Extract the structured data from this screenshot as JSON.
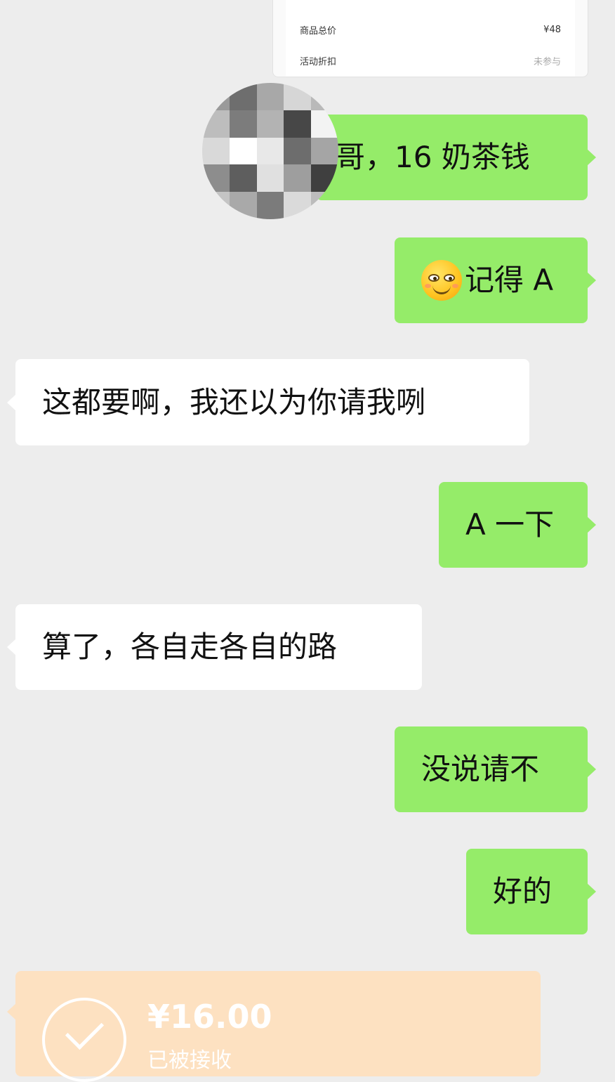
{
  "order_card": {
    "rows": [
      {
        "label": "商品总价",
        "value": "¥48"
      },
      {
        "label": "活动折扣",
        "value": "未参与"
      }
    ]
  },
  "messages": [
    {
      "direction": "out",
      "text": "哥，16 奶茶钱"
    },
    {
      "direction": "out",
      "emoji": "smug-face-icon",
      "text": "记得 A"
    },
    {
      "direction": "in",
      "text": "这都要啊，我还以为你请我咧"
    },
    {
      "direction": "out",
      "text": "A 一下"
    },
    {
      "direction": "in",
      "text": "算了，各自走各自的路"
    },
    {
      "direction": "out",
      "text": "没说请不"
    },
    {
      "direction": "out",
      "text": "好的"
    }
  ],
  "transfer": {
    "amount": "¥16.00",
    "status": "已被接收"
  },
  "colors": {
    "background": "#ededed",
    "outgoing_bubble": "#95ec69",
    "incoming_bubble": "#ffffff",
    "transfer_card": "#fde1c1"
  }
}
